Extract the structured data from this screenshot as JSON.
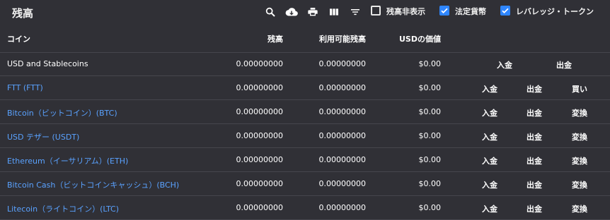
{
  "header": {
    "title": "残高",
    "hide_balance_label": "残高非表示",
    "fiat_label": "法定貨幣",
    "leveraged_label": "レバレッジ・トークン"
  },
  "columns": {
    "coin": "コイン",
    "balance": "残高",
    "available": "利用可能残高",
    "usd_value": "USDの価値"
  },
  "rows": [
    {
      "name": "USD and Stablecoins",
      "balance": "0.00000000",
      "available": "0.00000000",
      "usd": "$0.00",
      "a1": "入金",
      "a2": "出金",
      "a3": ""
    },
    {
      "name": "FTT (FTT)",
      "balance": "0.00000000",
      "available": "0.00000000",
      "usd": "$0.00",
      "a1": "入金",
      "a2": "出金",
      "a3": "買い"
    },
    {
      "name": "Bitcoin（ビットコイン）(BTC)",
      "balance": "0.00000000",
      "available": "0.00000000",
      "usd": "$0.00",
      "a1": "入金",
      "a2": "出金",
      "a3": "変換"
    },
    {
      "name": "USD テザー (USDT)",
      "balance": "0.00000000",
      "available": "0.00000000",
      "usd": "$0.00",
      "a1": "入金",
      "a2": "出金",
      "a3": "変換"
    },
    {
      "name": "Ethereum（イーサリアム）(ETH)",
      "balance": "0.00000000",
      "available": "0.00000000",
      "usd": "$0.00",
      "a1": "入金",
      "a2": "出金",
      "a3": "変換"
    },
    {
      "name": "Bitcoin Cash（ビットコインキャッシュ）(BCH)",
      "balance": "0.00000000",
      "available": "0.00000000",
      "usd": "$0.00",
      "a1": "入金",
      "a2": "出金",
      "a3": "変換"
    },
    {
      "name": "Litecoin（ライトコイン）(LTC)",
      "balance": "0.00000000",
      "available": "0.00000000",
      "usd": "$0.00",
      "a1": "入金",
      "a2": "出金",
      "a3": "変換"
    }
  ],
  "icons": [
    "search-icon",
    "cloud-download-icon",
    "print-icon",
    "columns-icon",
    "filter-icon"
  ],
  "colors": {
    "background": "#303036",
    "link": "#5aa2ff",
    "checkbox": "#2f86ff"
  }
}
